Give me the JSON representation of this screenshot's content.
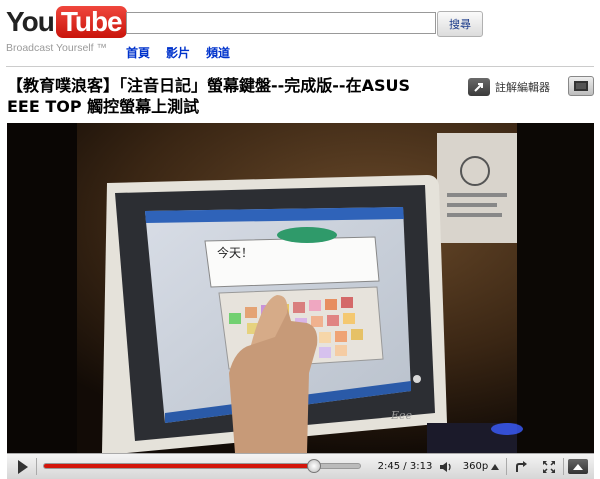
{
  "header": {
    "logo_you": "You",
    "logo_tube": "Tube",
    "logo_tagline": "Broadcast Yourself ™",
    "search": {
      "value": "",
      "placeholder": "",
      "button_label": "搜尋"
    },
    "nav": [
      {
        "label": "首頁"
      },
      {
        "label": "影片"
      },
      {
        "label": "頻道"
      }
    ]
  },
  "video": {
    "title": "【教育噗浪客】「注音日記」螢幕鍵盤--完成版--在ASUS EEE TOP 觸控螢幕上測試",
    "annotations_button_label": "註解編輯器",
    "screen_text": "今天！",
    "monitor_brand": "Eee"
  },
  "player": {
    "current_time": "2:45",
    "duration": "3:13",
    "time_display": "2:45 / 3:13",
    "progress_fraction": 0.855,
    "quality_label": "360p",
    "colors": {
      "progress": "#d3150b",
      "logo_red": "#e62117"
    },
    "icons": [
      "play-icon",
      "volume-icon",
      "popout-icon",
      "fullscreen-icon",
      "menu-icon",
      "annotations-icon"
    ]
  }
}
